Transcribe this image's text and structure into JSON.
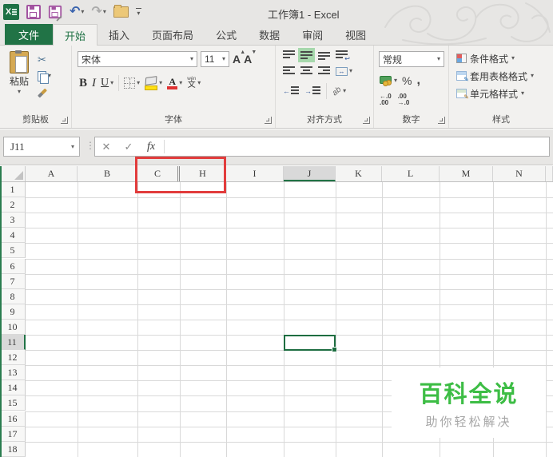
{
  "window": {
    "title": "工作簿1 - Excel"
  },
  "quick_access": {
    "icons": [
      "excel-logo",
      "save",
      "save-as",
      "undo",
      "redo",
      "open-folder",
      "customize-toolbar"
    ]
  },
  "tabs": {
    "file_label": "文件",
    "items": [
      "开始",
      "插入",
      "页面布局",
      "公式",
      "数据",
      "审阅",
      "视图"
    ],
    "active": "开始"
  },
  "ribbon": {
    "clipboard": {
      "label": "剪贴板",
      "paste_label": "粘贴"
    },
    "font": {
      "label": "字体",
      "family": "宋体",
      "size": "11",
      "bold": "B",
      "italic": "I",
      "underline": "U",
      "grow": "A",
      "shrink": "A",
      "pinyin_top": "wén",
      "pinyin_char": "文"
    },
    "alignment": {
      "label": "对齐方式",
      "orientation_text": "ab"
    },
    "number": {
      "label": "数字",
      "format": "常规",
      "percent": "%",
      "comma": ",",
      "inc_top": "←.0",
      "inc_bottom": ".00",
      "dec_top": ".00",
      "dec_bottom": "→.0"
    },
    "styles": {
      "label": "样式",
      "items": [
        "条件格式",
        "套用表格格式",
        "单元格样式"
      ]
    }
  },
  "formula_bar": {
    "name_box": "J11",
    "cancel": "✕",
    "enter": "✓",
    "fx": "fx",
    "input_value": ""
  },
  "grid": {
    "columns": [
      "A",
      "B",
      "C",
      "H",
      "I",
      "J",
      "K",
      "L",
      "M",
      "N"
    ],
    "selected_column": "J",
    "hidden_gap_after": "C",
    "row_numbers": [
      1,
      2,
      3,
      4,
      5,
      6,
      7,
      8,
      9,
      10,
      11,
      12,
      13,
      14,
      15,
      16,
      17,
      18
    ],
    "selected_row": 11,
    "selected_cell": "J11"
  },
  "watermark": {
    "title": "百科全说",
    "subtitle": "助你轻松解决"
  },
  "colors": {
    "excel_green": "#217346",
    "selection_green": "#1e6e41",
    "highlight_green": "#a6d8ac",
    "annotation_red": "#e23c3c",
    "watermark_green": "#3dbd45"
  }
}
